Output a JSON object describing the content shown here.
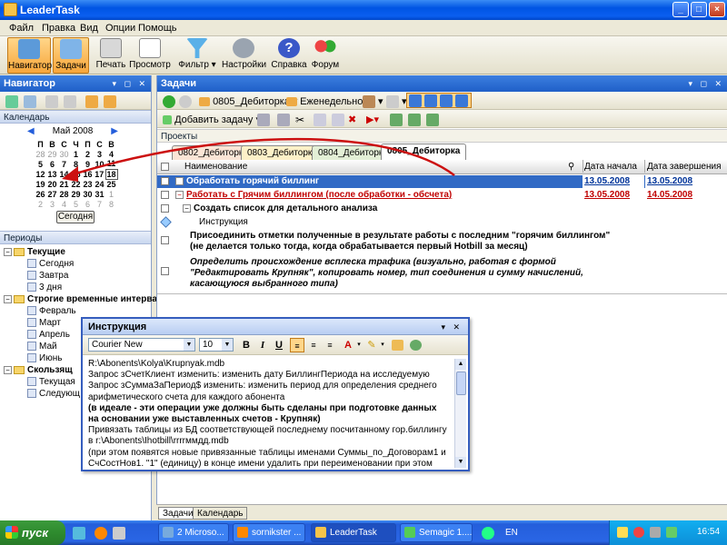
{
  "window": {
    "title": "LeaderTask"
  },
  "menu": [
    "Файл",
    "Правка",
    "Вид",
    "Опции",
    "Помощь"
  ],
  "toolbar": {
    "buttons": [
      {
        "label": "Навигатор",
        "active": true
      },
      {
        "label": "Задачи",
        "active": true
      },
      {
        "label": "Печать"
      },
      {
        "label": "Просмотр"
      },
      {
        "label": "Фильтр"
      },
      {
        "label": "Настройки"
      },
      {
        "label": "Справка"
      },
      {
        "label": "Форум"
      }
    ]
  },
  "navigator": {
    "title": "Навигатор",
    "calendar_label": "Календарь",
    "calendar": {
      "month": "Май 2008",
      "weekdays": [
        "П",
        "В",
        "С",
        "Ч",
        "П",
        "С",
        "В"
      ],
      "weeks": [
        [
          "28",
          "29",
          "30",
          "1",
          "2",
          "3",
          "4"
        ],
        [
          "5",
          "6",
          "7",
          "8",
          "9",
          "10",
          "11"
        ],
        [
          "12",
          "13",
          "14",
          "15",
          "16",
          "17",
          "18"
        ],
        [
          "19",
          "20",
          "21",
          "22",
          "23",
          "24",
          "25"
        ],
        [
          "26",
          "27",
          "28",
          "29",
          "30",
          "31",
          "1"
        ],
        [
          "2",
          "3",
          "4",
          "5",
          "6",
          "7",
          "8"
        ]
      ],
      "today_button": "Сегодня"
    },
    "periods_label": "Периоды",
    "tree": {
      "current": "Текущие",
      "today": "Сегодня",
      "tomorrow": "Завтра",
      "three_days": "3 дня",
      "strict": "Строгие временные интерва",
      "feb": "Февраль",
      "mar": "Март",
      "apr": "Апрель",
      "may": "Май",
      "jun": "Июнь",
      "sliding": "Скользящ",
      "current_short": "Текущая",
      "next": "Следующ"
    }
  },
  "tasks": {
    "title": "Задачи",
    "folder": "0805_Дебиторка",
    "period": "Еженедельно",
    "add_task": "Добавить задачу",
    "projects_label": "Проекты",
    "tabs": [
      "0802_Дебиторка",
      "0803_Дебиторка",
      "0804_Дебиторка",
      "0805_Дебиторка"
    ],
    "columns": {
      "name": "Наименование",
      "start": "Дата начала",
      "end": "Дата завершения"
    },
    "rows": [
      {
        "name": "Обработать горячий биллинг",
        "start": "13.05.2008",
        "end": "13.05.2008"
      },
      {
        "name": "Работать с Грячим биллингом (после обработки - обсчета)",
        "start": "13.05.2008",
        "end": "14.05.2008"
      },
      {
        "name": "Создать список для детального анализа"
      },
      {
        "name": "Инструкция"
      },
      {
        "line1": "Присоединить отметки полученные в результате работы с последним \"горячим биллингом\"",
        "line2": "(не делается только тогда, когда обрабатывается первый Hotbill за месяц)"
      },
      {
        "line1": "Определить происхождение всплеска трафика (визуально, работая с формой",
        "line2": "\"Редактировать Крупняк\", копировать номер, тип соединения и сумму начислений,",
        "line3": "касающуюся выбранного типа)"
      }
    ],
    "bottom_tabs": [
      "Задачи",
      "Календарь"
    ]
  },
  "instruction": {
    "title": "Инструкция",
    "font": "Courier New",
    "size": "10",
    "lines": [
      {
        "text": "R:\\Abonents\\Kolya\\Krupnyak.mdb",
        "bold": false
      },
      {
        "text": "Запрос зСчетКлиент изменить: изменить дату БиллингПериода на исследуемую",
        "bold": false
      },
      {
        "text": "Запрос зСуммаЗаПериод$ изменить: изменить период для определения среднего",
        "bold": false
      },
      {
        "text": "арифметического счета для каждого абонента",
        "bold": false
      },
      {
        "text": "(в идеале - эти операции уже должны быть сделаны при подготовке данных",
        "bold": true
      },
      {
        "text": "на основании уже выставленных счетов - Крупняк)",
        "bold": true
      },
      {
        "text": "Привязать таблицы из БД соответствующей последнему посчитанному гор.биллингу",
        "bold": false
      },
      {
        "text": "в r:\\Abonents\\Ihotbill\\rrrrммдд.mdb",
        "bold": false
      },
      {
        "text": "(при этом появятся новые привязанные таблицы именами Суммы_по_Договорам1 и",
        "bold": false
      },
      {
        "text": "СчСостНов1. \"1\" (единицу) в конце имени удалить при переименовании при этом",
        "bold": false
      }
    ]
  },
  "taskbar": {
    "start": "пуск",
    "tasks": [
      "2 Microso...",
      "sornikster ...",
      "LeaderTask",
      "Semagic 1...."
    ],
    "lang": "EN",
    "clock": "16:54"
  },
  "colors": {
    "accent": "#245edb",
    "selected_row": "#316ac5",
    "link_red": "#c00000"
  }
}
